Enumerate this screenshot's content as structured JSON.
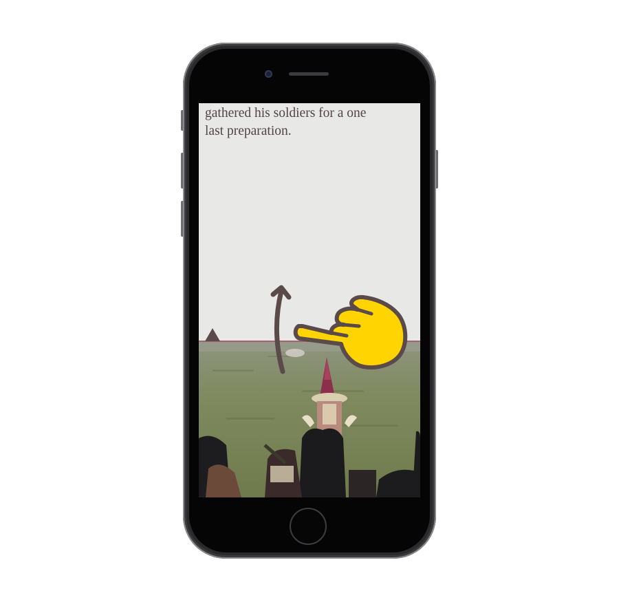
{
  "story": {
    "line1": "gathered his soldiers for a one",
    "line2": "last preparation."
  },
  "gesture": {
    "arrow_icon": "swipe-up-arrow-icon",
    "hand_icon": "pointing-hand-icon",
    "hand_color": "#ffd400",
    "arrow_color": "#5a4a4a"
  },
  "colors": {
    "paper": "#e8e8e6",
    "text": "#4f4548",
    "divider": "#a4636c"
  }
}
